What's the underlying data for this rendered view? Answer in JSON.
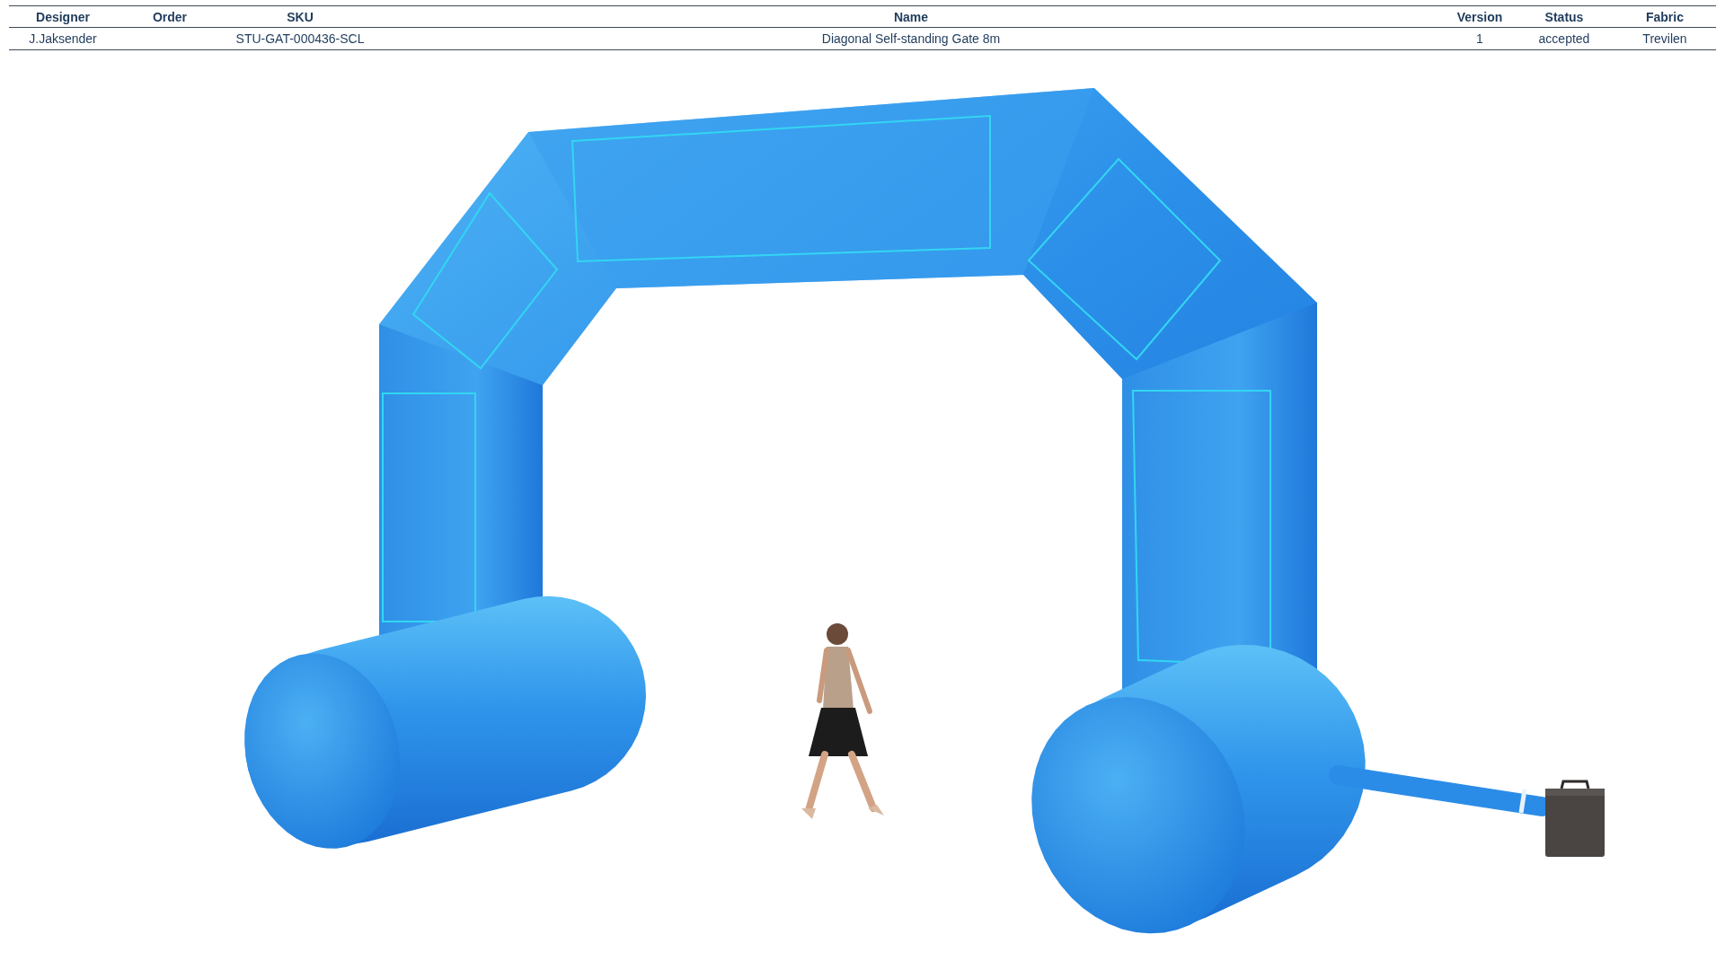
{
  "table": {
    "columns": [
      "Designer",
      "Order",
      "SKU",
      "Name",
      "Version",
      "Status",
      "Fabric"
    ],
    "rows": [
      {
        "designer": "J.Jaksender",
        "sku": "STU-GAT-000436-SCL",
        "name": "Diagonal Self-standing Gate 8m",
        "version": "1",
        "status": "accepted",
        "fabric": "Trevilen"
      }
    ]
  }
}
